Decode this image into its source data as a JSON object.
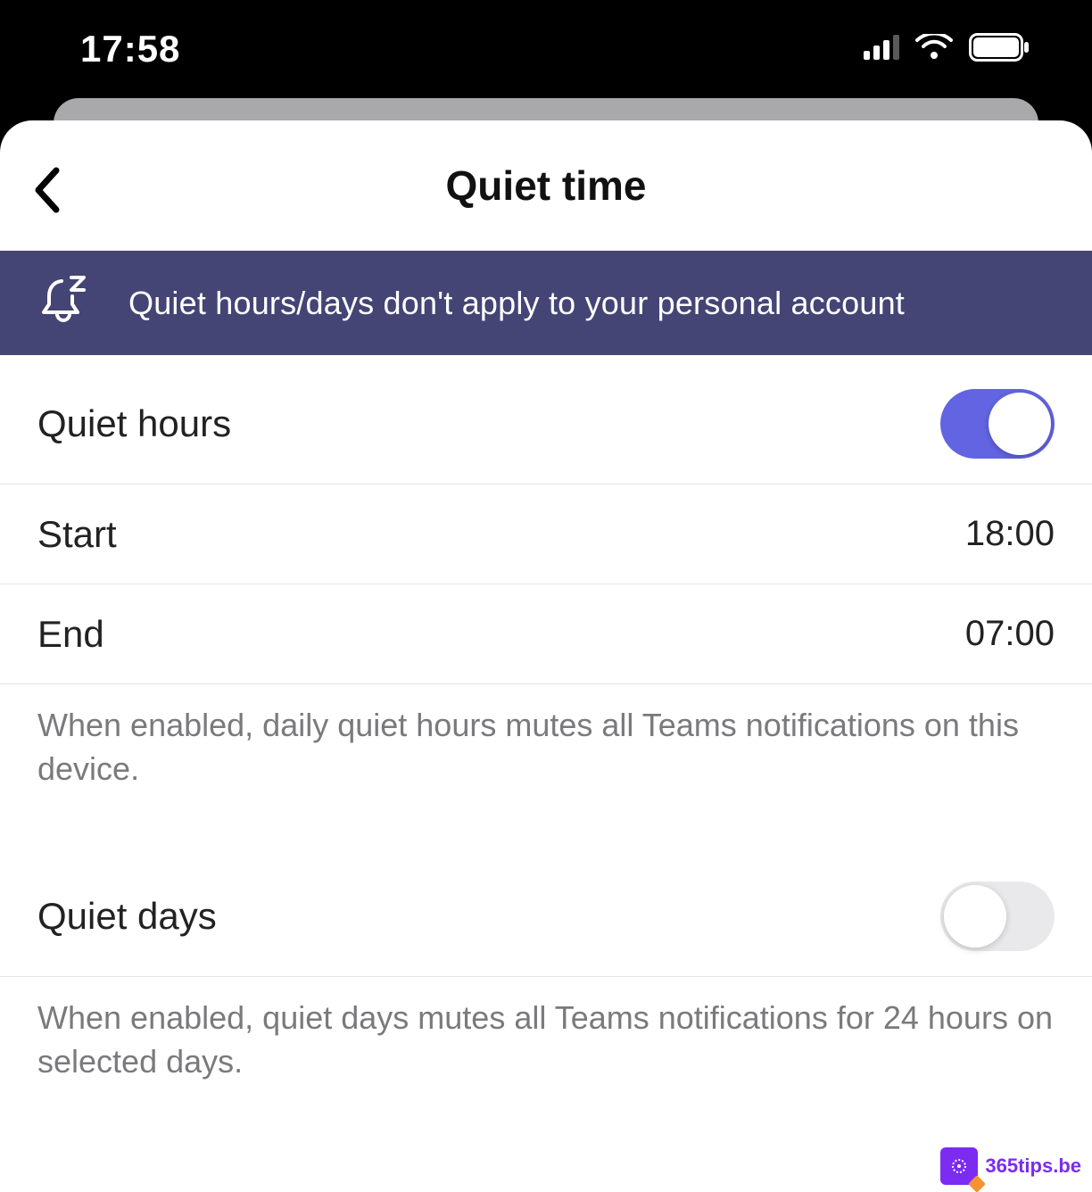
{
  "statusbar": {
    "time": "17:58"
  },
  "nav": {
    "title": "Quiet time"
  },
  "banner": {
    "text": "Quiet hours/days don't apply to your personal account"
  },
  "quiet_hours": {
    "label": "Quiet hours",
    "enabled": true,
    "start_label": "Start",
    "start_value": "18:00",
    "end_label": "End",
    "end_value": "07:00",
    "hint": "When enabled, daily quiet hours mutes all Teams notifications on this device."
  },
  "quiet_days": {
    "label": "Quiet days",
    "enabled": false,
    "hint": "When enabled, quiet days mutes all Teams notifications for 24 hours on selected days."
  },
  "watermark": {
    "text": "365tips.be"
  }
}
